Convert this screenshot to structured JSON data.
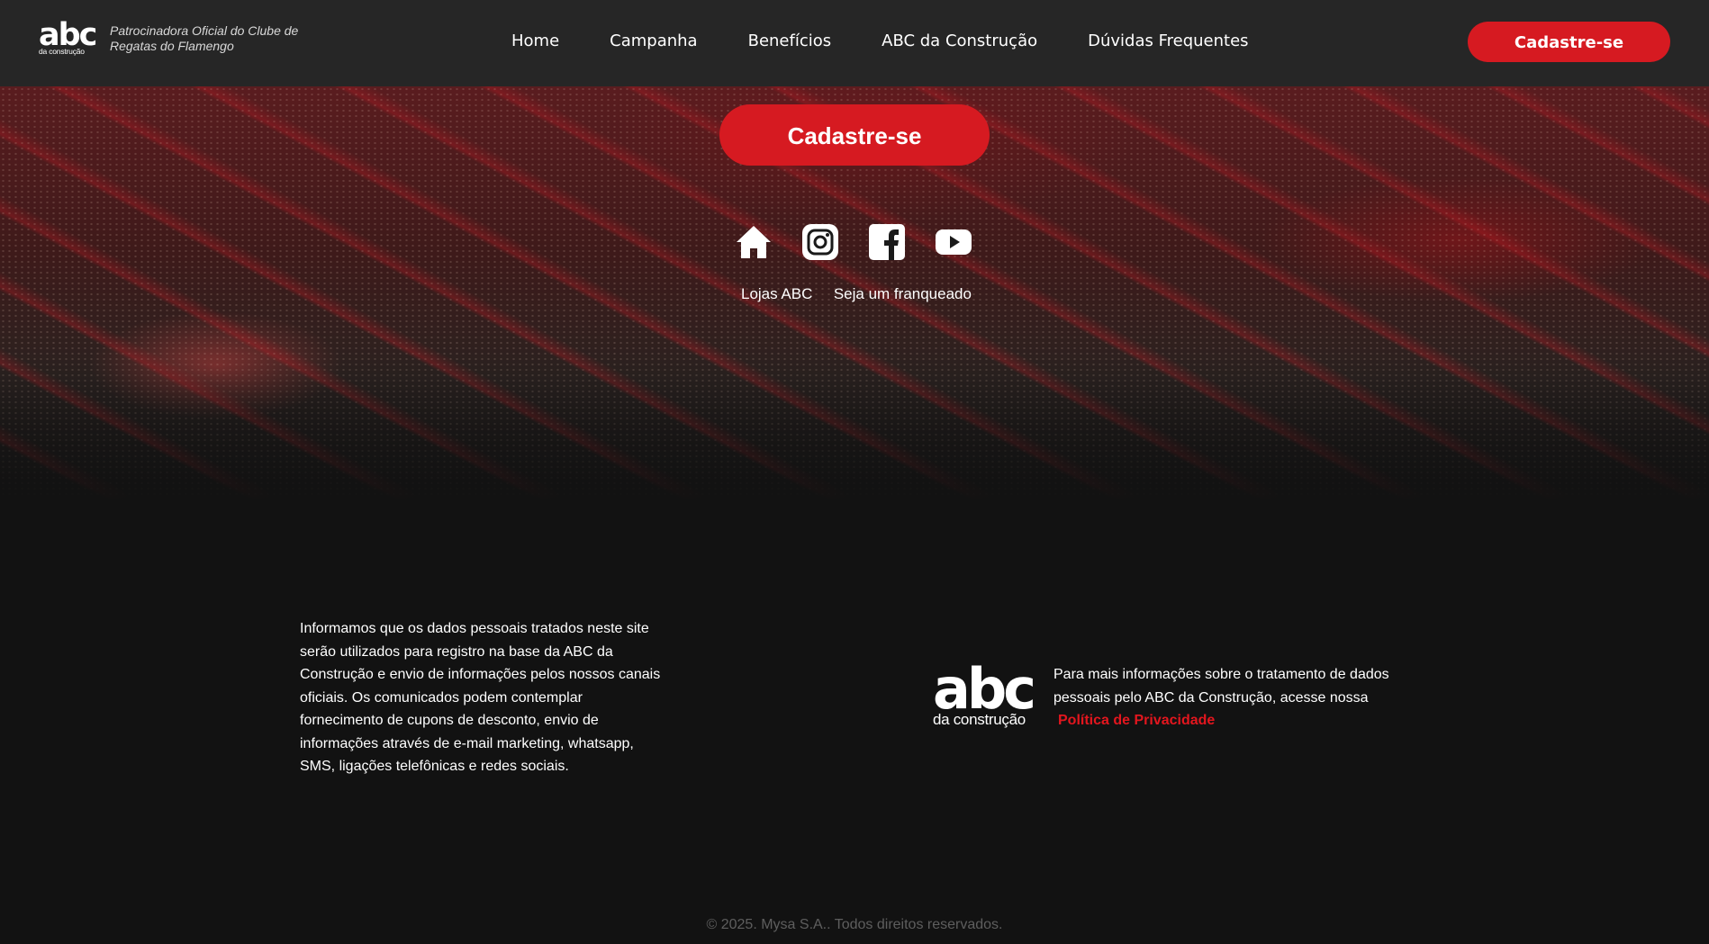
{
  "header": {
    "logo": {
      "main": "abc",
      "sub": "da construção"
    },
    "tagline": "Patrocinadora Oficial do Clube de Regatas do Flamengo",
    "nav": [
      {
        "label": "Home"
      },
      {
        "label": "Campanha"
      },
      {
        "label": "Benefícios"
      },
      {
        "label": "ABC da Construção"
      },
      {
        "label": "Dúvidas Frequentes"
      }
    ],
    "cta_label": "Cadastre-se"
  },
  "hero": {
    "cta_label": "Cadastre-se",
    "social_icons": [
      "home-icon",
      "instagram-icon",
      "facebook-icon",
      "youtube-icon"
    ],
    "links": [
      {
        "label": "Lojas ABC"
      },
      {
        "label": "Seja um franqueado"
      }
    ]
  },
  "footer": {
    "disclaimer": "Informamos que os dados pessoais tratados neste site serão utilizados para registro na base da ABC da Construção e envio de informações pelos nossos canais oficiais. Os comunicados podem contemplar fornecimento de cupons de desconto, envio de informações através de e-mail marketing, whatsapp, SMS, ligações telefônicas e redes sociais.",
    "logo": {
      "main": "abc",
      "sub": "da construção"
    },
    "privacy_text": "Para mais informações sobre o tratamento de dados pessoais pelo ABC da Construção, acesse nossa",
    "privacy_link": "Política de Privacidade",
    "copyright": "© 2025. Mysa S.A.. Todos direitos reservados."
  },
  "colors": {
    "accent_red": "#d61a21",
    "link_red": "#e3161e",
    "header_bg": "#262626",
    "page_bg": "#121212"
  }
}
